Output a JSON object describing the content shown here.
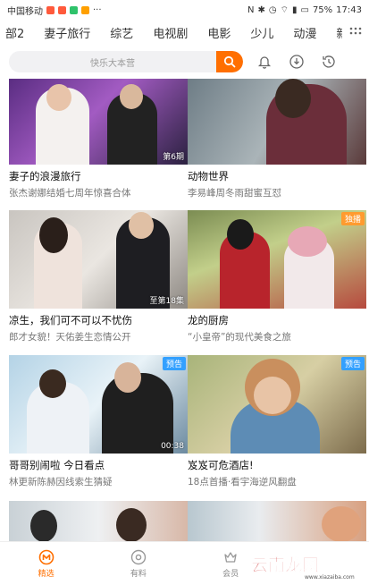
{
  "statusbar": {
    "carrier": "中国移动",
    "battery": "75%",
    "time": "17:43",
    "colors": {
      "badge1": "#ff5a3c",
      "badge2": "#ff5a3c",
      "badge3": "#2fc26b",
      "badge4": "#ffa000"
    }
  },
  "tabs": [
    "部2",
    "妻子旅行",
    "综艺",
    "电视剧",
    "电影",
    "少儿",
    "动漫",
    "新闻"
  ],
  "search": {
    "placeholder": "快乐大本营"
  },
  "cards": [
    {
      "title": "妻子的浪漫旅行",
      "subtitle": "张杰谢娜结婚七周年惊喜合体",
      "episode": "第6期",
      "tag": ""
    },
    {
      "title": "动物世界",
      "subtitle": "李易峰周冬雨甜蜜互怼",
      "episode": "",
      "tag": ""
    },
    {
      "title": "凉生，我们可不可以不忧伤",
      "subtitle": "郎才女貌！天佑姜生恋情公开",
      "episode": "至第18集",
      "tag": ""
    },
    {
      "title": "龙的厨房",
      "subtitle": "“小皇帝”的现代美食之旅",
      "episode": "",
      "tag": "独播"
    },
    {
      "title": "哥哥别闹啦 今日看点",
      "subtitle": "林更新陈赫因线索生猜疑",
      "episode": "00:38",
      "tag": "预告"
    },
    {
      "title": "岌岌可危酒店!",
      "subtitle": "18点首播·看宇海逆风翻盘",
      "episode": "",
      "tag": "预告"
    },
    {
      "title": "",
      "subtitle": "",
      "episode": "",
      "tag": ""
    },
    {
      "title": "",
      "subtitle": "",
      "episode": "",
      "tag": ""
    }
  ],
  "bottomnav": [
    {
      "label": "精选",
      "icon": "featured-icon",
      "active": true
    },
    {
      "label": "有料",
      "icon": "discover-icon",
      "active": false
    },
    {
      "label": "会员",
      "icon": "vip-icon",
      "active": false
    }
  ],
  "watermark": {
    "text": "云南龙网",
    "url": "www.xiazaiba.com"
  },
  "accent": "#ff6f00"
}
